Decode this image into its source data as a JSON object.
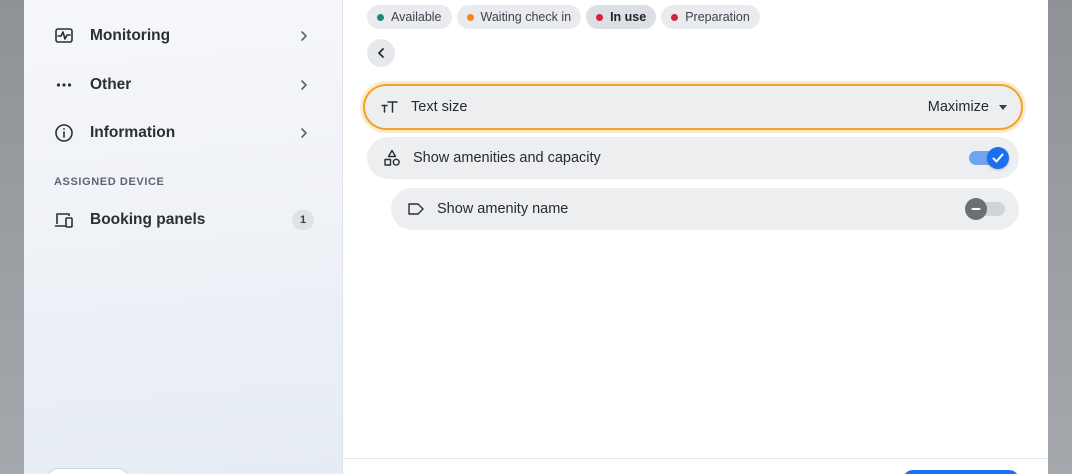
{
  "sidebar": {
    "items": [
      {
        "label": "Monitoring",
        "icon": "monitoring-icon"
      },
      {
        "label": "Other",
        "icon": "more-horizontal-icon"
      },
      {
        "label": "Information",
        "icon": "info-icon"
      }
    ],
    "section_title": "ASSIGNED DEVICE",
    "device_item": {
      "label": "Booking panels",
      "count": "1",
      "icon": "devices-icon"
    }
  },
  "status_chips": [
    {
      "label": "Available",
      "color": "#1a8a7a",
      "active": false
    },
    {
      "label": "Waiting check in",
      "color": "#f08a12",
      "active": false
    },
    {
      "label": "In use",
      "color": "#d81f3c",
      "active": true
    },
    {
      "label": "Preparation",
      "color": "#d81f3c",
      "active": false
    }
  ],
  "settings": {
    "text_size": {
      "label": "Text size",
      "value": "Maximize",
      "icon": "text-size-icon"
    },
    "show_amenities": {
      "label": "Show amenities and capacity",
      "checked": true,
      "icon": "shapes-icon"
    },
    "show_amenity_name": {
      "label": "Show amenity name",
      "checked": false,
      "icon": "label-icon"
    }
  },
  "colors": {
    "accent": "#1a6ff0",
    "focus_ring": "#f0a420"
  }
}
